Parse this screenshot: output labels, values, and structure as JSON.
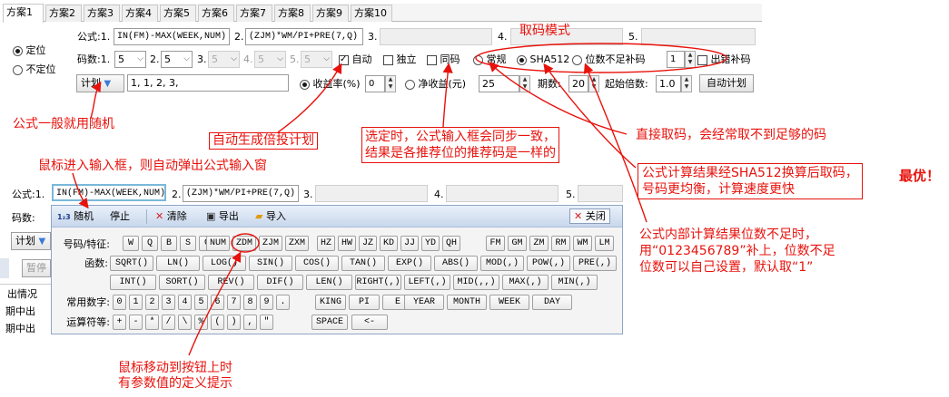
{
  "tabs": [
    "方案1",
    "方案2",
    "方案3",
    "方案4",
    "方案5",
    "方案6",
    "方案7",
    "方案8",
    "方案9",
    "方案10"
  ],
  "top": {
    "mode_fixed": "定位",
    "mode_unfixed": "不定位",
    "formula_label": "公式:",
    "f1_idx": "1.",
    "f1_val": "IN(FM)-MAX(WEEK,NUM)",
    "f2_idx": "2.",
    "f2_val": "(ZJM)*WM/PI+PRE(7,Q)",
    "f3_idx": "3.",
    "f4_idx": "4.",
    "f5_idx": "5.",
    "digits_label": "码数:",
    "d1_idx": "1.",
    "d1_val": "5",
    "d2_idx": "2.",
    "d2_val": "5",
    "d3_idx": "3.",
    "d3_val": "5",
    "d4_idx": "4.",
    "d4_val": "5",
    "d5_idx": "5.",
    "d5_val": "5",
    "auto_label": "自动",
    "independent_label": "独立",
    "same_label": "同码",
    "normal_label": "常规",
    "sha_label": "SHA512",
    "pad_label": "位数不足补码",
    "pad_val": "1",
    "error_pad_label": "出错补码",
    "plan_btn": "计划",
    "plan_val": "1, 1, 2, 3,",
    "yield_label": "收益率(%)",
    "yield_val": "0",
    "net_label": "净收益(元)",
    "net_val": "25",
    "periods_label": "期数:",
    "periods_val": "20",
    "start_mult_label": "起始倍数:",
    "start_mult_val": "1.0",
    "auto_plan_btn": "自动计划"
  },
  "second": {
    "formula_label": "公式:",
    "f1_idx": "1.",
    "f1_val": "IN(FM)-MAX(WEEK,NUM)",
    "f2_idx": "2.",
    "f2_val": "(ZJM)*WM/PI+PRE(7,Q)",
    "f3_idx": "3.",
    "f4_idx": "4.",
    "f5_idx": "5.",
    "digits_label": "码数:",
    "plan_btn": "计划",
    "pause_btn": "暂停",
    "status_header": "出情况",
    "row1": "期中出",
    "row2": "期中出"
  },
  "panel": {
    "random": "随机",
    "stop": "停止",
    "clear": "清除",
    "export": "导出",
    "import": "导入",
    "close": "关闭",
    "row_labels": [
      "号码/特征:",
      "函数:",
      "",
      "常用数字:",
      "运算符等:"
    ],
    "features_a": [
      "W",
      "Q",
      "B",
      "S",
      "G"
    ],
    "features_b": [
      "NUM",
      "ZDM",
      "ZJM",
      "ZXM"
    ],
    "features_c": [
      "HZ",
      "HW",
      "JZ",
      "KD",
      "JJ",
      "YD",
      "QH"
    ],
    "features_d": [
      "FM",
      "GM",
      "ZM",
      "RM",
      "WM",
      "LM"
    ],
    "funcs1": [
      "SQRT()",
      "LN()",
      "LOG()",
      "SIN()",
      "COS()",
      "TAN()",
      "EXP()",
      "ABS()",
      "MOD(,)",
      "POW(,)",
      "PRE(,)"
    ],
    "funcs2": [
      "INT()",
      "SORT()",
      "REV()",
      "DIF()",
      "LEN()",
      "RIGHT(,)",
      "LEFT(,)",
      "MID(,,)",
      "MAX(,)",
      "MIN(,)"
    ],
    "digits": [
      "0",
      "1",
      "2",
      "3",
      "4",
      "5",
      "6",
      "7",
      "8",
      "9",
      "."
    ],
    "digits_extra": [
      "KING",
      "PI",
      "E"
    ],
    "digits_time": [
      "YEAR",
      "MONTH",
      "WEEK",
      "DAY"
    ],
    "ops": [
      "+",
      "-",
      "*",
      "/",
      "\\",
      "%",
      "(",
      ")",
      ",",
      "\""
    ],
    "ops_extra": [
      "SPACE",
      "<-"
    ]
  },
  "annotations": {
    "mode_title": "取码模式",
    "formula_random": "公式一般就用随机",
    "auto_plan": "自动生成倍投计划",
    "hover_input": "鼠标进入输入框，则自动弹出公式输入窗",
    "same_code_1": "选定时，公式输入框会同步一致，",
    "same_code_2": "结果是各推荐位的推荐码是一样的",
    "direct": "直接取码，会经常取不到足够的码",
    "sha_1": "公式计算结果经SHA512换算后取码，",
    "sha_2": "号码更均衡，计算速度更快",
    "best": "最优！",
    "pad_1": "公式内部计算结果位数不足时，",
    "pad_2": "用“0123456789”补上，位数不足",
    "pad_3": "位数可以自己设置，默认取“1”",
    "hover_btn_1": "鼠标移动到按钮上时",
    "hover_btn_2": "有参数值的定义提示"
  }
}
